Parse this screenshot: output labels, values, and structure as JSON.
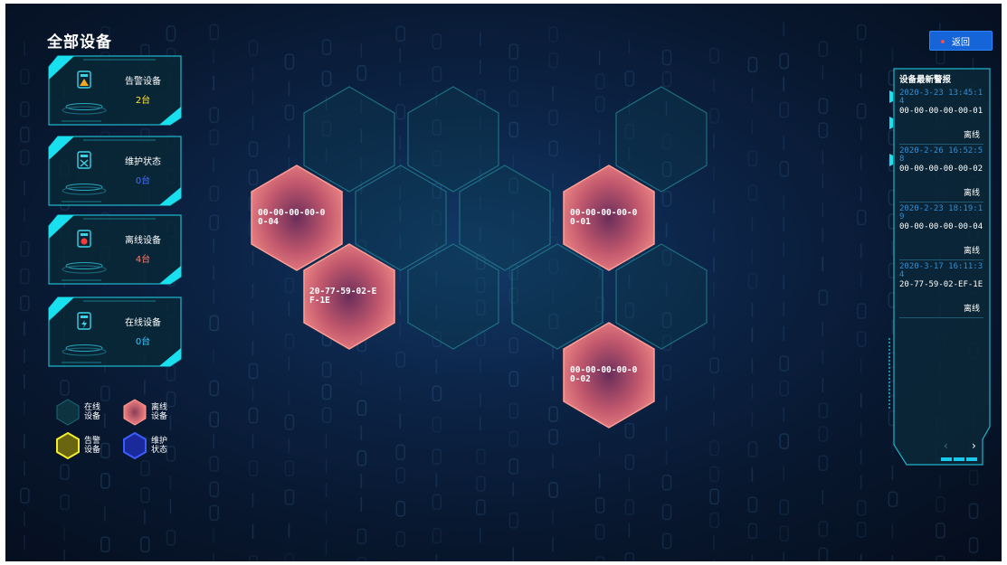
{
  "page": {
    "title": "全部设备",
    "back_label": "返回"
  },
  "stats": [
    {
      "label": "告警设备",
      "count": "2台",
      "color": "#ffe43a",
      "icon": "warning-device-icon"
    },
    {
      "label": "维护状态",
      "count": "0台",
      "color": "#4b6cff",
      "icon": "maintenance-tools-icon"
    },
    {
      "label": "离线设备",
      "count": "4台",
      "color": "#ff7b6b",
      "icon": "offline-device-icon"
    },
    {
      "label": "在线设备",
      "count": "0台",
      "color": "#3cc9ff",
      "icon": "online-device-icon"
    }
  ],
  "legend": [
    {
      "label": "在线设备",
      "color": "#0f3a47"
    },
    {
      "label": "离线设备",
      "color": "#e87070"
    },
    {
      "label": "告警设备",
      "color": "#e6e021"
    },
    {
      "label": "维护状态",
      "color": "#2f4fe0"
    }
  ],
  "hexes": {
    "offline": [
      {
        "device": "00-00-00-00-00-04"
      },
      {
        "device": "20-77-59-02-EF-1E"
      },
      {
        "device": "00-00-00-00-00-01"
      },
      {
        "device": "00-00-00-00-00-02"
      }
    ]
  },
  "panel": {
    "title": "设备最新警报",
    "items": [
      {
        "date": "2020-3-23 13:45:14",
        "device": "00-00-00-00-00-01",
        "status": "离线"
      },
      {
        "date": "2020-2-26 16:52:58",
        "device": "00-00-00-00-00-02",
        "status": "离线"
      },
      {
        "date": "2020-2-23 18:19:19",
        "device": "00-00-00-00-00-04",
        "status": "离线"
      },
      {
        "date": "2020-3-17 16:11:34",
        "device": "20-77-59-02-EF-1E",
        "status": "离线"
      }
    ],
    "prev": "‹",
    "next": "›"
  }
}
